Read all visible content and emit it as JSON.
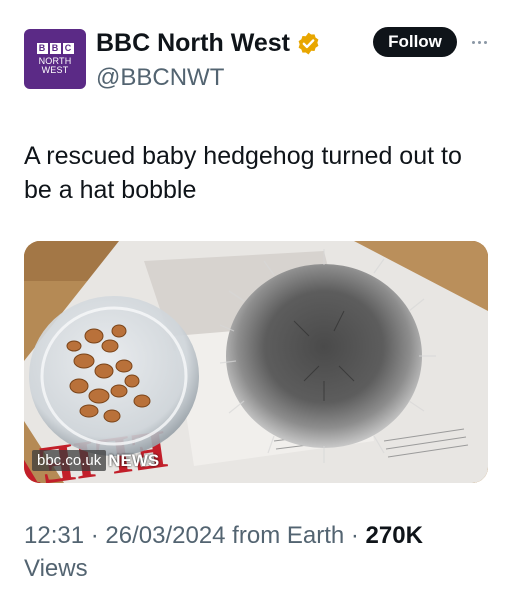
{
  "account": {
    "display_name": "BBC North West",
    "handle": "@BBCNWT",
    "avatar_blocks": [
      "B",
      "B",
      "C"
    ],
    "avatar_sub_line1": "NORTH",
    "avatar_sub_line2": "WEST",
    "avatar_color": "#5b2a86",
    "verified_color": "#e8a600"
  },
  "actions": {
    "follow_label": "Follow",
    "more_icon": "more-horizontal-icon"
  },
  "tweet": {
    "text": "A rescued baby hedgehog turned out to be a hat bobble"
  },
  "media": {
    "watermark_url": "bbc.co.uk",
    "watermark_tag": "NEWS",
    "newspaper_headline": "ELIEVE"
  },
  "meta": {
    "time": "12:31",
    "sep1": " · ",
    "date": "26/03/2024",
    "source": " from Earth",
    "sep2": " · ",
    "views_count": "270K",
    "views_label": "Views"
  }
}
